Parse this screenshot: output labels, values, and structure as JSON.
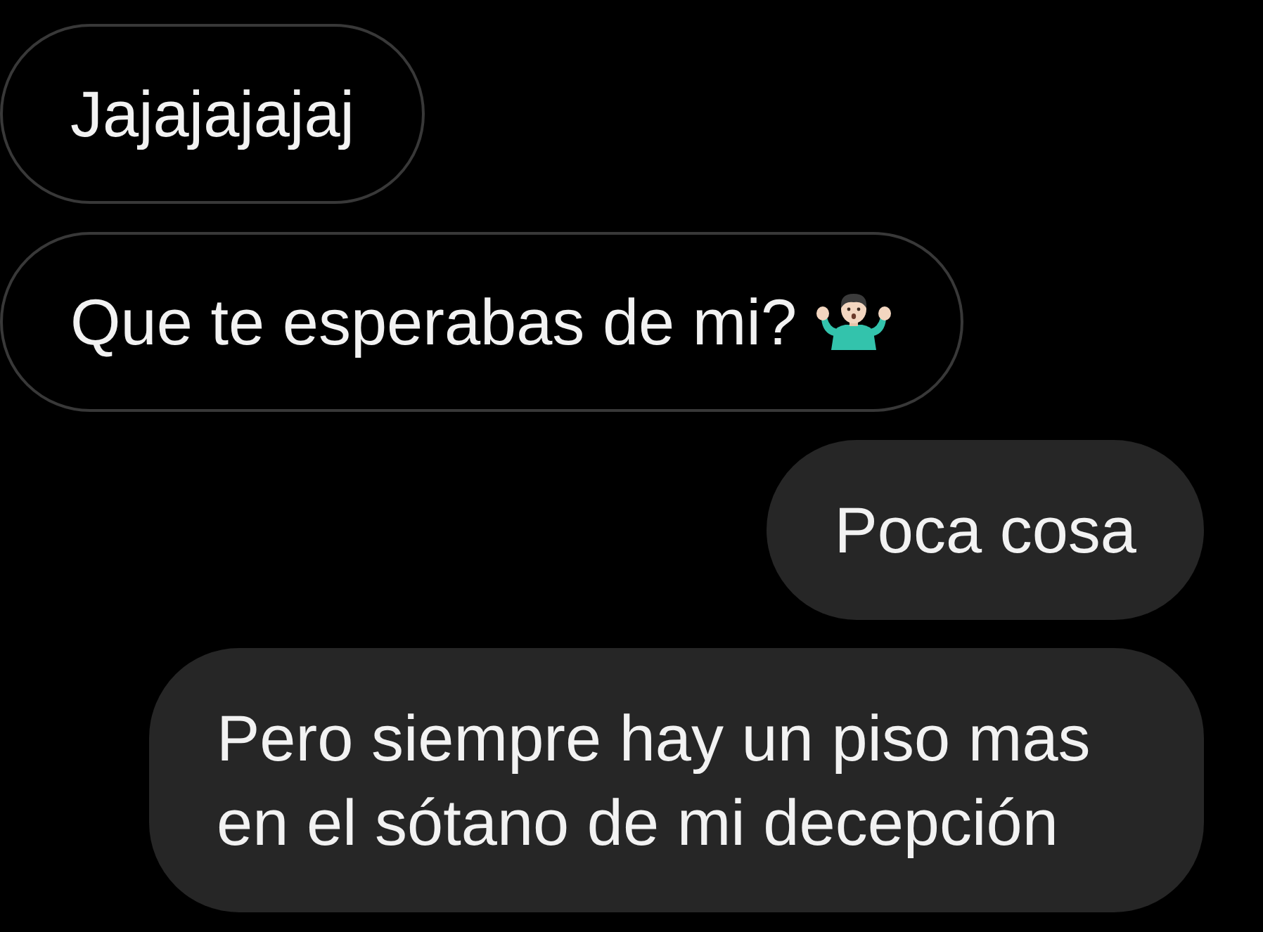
{
  "messages": [
    {
      "kind": "incoming",
      "text": "Jajajajajaj",
      "trailing_emoji": false
    },
    {
      "kind": "incoming",
      "text": "Que te esperabas de mi?",
      "trailing_emoji": true
    },
    {
      "kind": "outgoing",
      "text": "Poca cosa",
      "trailing_emoji": false
    },
    {
      "kind": "outgoing",
      "text": "Pero siempre hay un piso mas en el sótano de mi decepción",
      "trailing_emoji": false
    }
  ]
}
